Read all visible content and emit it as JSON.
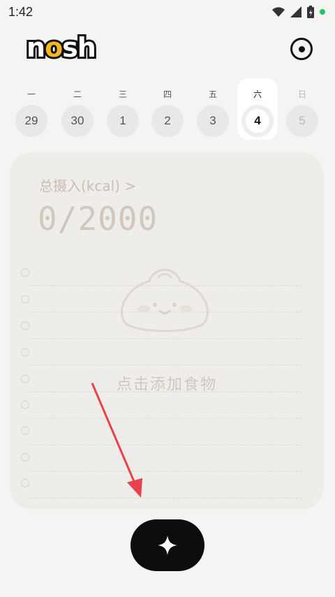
{
  "status_bar": {
    "time": "1:42"
  },
  "app": {
    "logo_text": "nosh"
  },
  "week": [
    {
      "weekday": "一",
      "date": "29",
      "state": "past"
    },
    {
      "weekday": "二",
      "date": "30",
      "state": "past"
    },
    {
      "weekday": "三",
      "date": "1",
      "state": "past"
    },
    {
      "weekday": "四",
      "date": "2",
      "state": "past"
    },
    {
      "weekday": "五",
      "date": "3",
      "state": "past"
    },
    {
      "weekday": "六",
      "date": "4",
      "state": "selected"
    },
    {
      "weekday": "日",
      "date": "5",
      "state": "future"
    }
  ],
  "card": {
    "intake_label": "总摄入(kcal) >",
    "intake_value": "0/2000",
    "empty_text": "点击添加食物"
  },
  "fab": {
    "icon": "sparkle-plus-icon"
  },
  "colors": {
    "accent": "#f5b51f",
    "fab": "#0d0d0d",
    "annotation_arrow": "#e8424d"
  }
}
